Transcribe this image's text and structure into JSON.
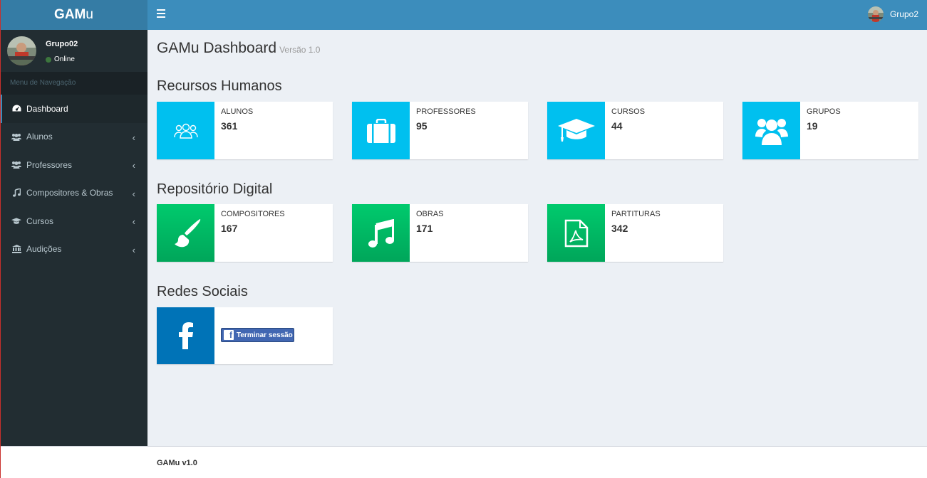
{
  "header": {
    "logo_bold": "GAM",
    "logo_rest": "u",
    "user_name": "Grupo2"
  },
  "sidebar": {
    "user_name": "Grupo02",
    "status": "Online",
    "menu_header": "Menu de Navegação",
    "items": [
      {
        "label": "Dashboard",
        "icon": "dashboard-icon"
      },
      {
        "label": "Alunos",
        "icon": "users-icon"
      },
      {
        "label": "Professores",
        "icon": "users-icon"
      },
      {
        "label": "Compositores & Obras",
        "icon": "music-icon"
      },
      {
        "label": "Cursos",
        "icon": "graduation-cap-icon"
      },
      {
        "label": "Audições",
        "icon": "institution-icon"
      }
    ],
    "chevron": "‹"
  },
  "main": {
    "title": "GAMu Dashboard",
    "version": "Versão 1.0",
    "sections": [
      {
        "title": "Recursos Humanos",
        "boxes": [
          {
            "label": "ALUNOS",
            "value": "361",
            "icon": "users-outline-icon",
            "color": "#00c0ef"
          },
          {
            "label": "PROFESSORES",
            "value": "95",
            "icon": "briefcase-icon",
            "color": "#00c0ef"
          },
          {
            "label": "CURSOS",
            "value": "44",
            "icon": "graduation-cap-icon",
            "color": "#00c0ef"
          },
          {
            "label": "GRUPOS",
            "value": "19",
            "icon": "users-icon",
            "color": "#00c0ef"
          }
        ]
      },
      {
        "title": "Repositório Digital",
        "boxes": [
          {
            "label": "COMPOSITORES",
            "value": "167",
            "icon": "paint-brush-icon",
            "color": "#00a65a"
          },
          {
            "label": "OBRAS",
            "value": "171",
            "icon": "music-icon",
            "color": "#00a65a"
          },
          {
            "label": "PARTITURAS",
            "value": "342",
            "icon": "file-pdf-icon",
            "color": "#00a65a"
          }
        ]
      },
      {
        "title": "Redes Sociais",
        "facebook_button": "Terminar sessão",
        "icon": "facebook-icon",
        "color": "#0073b7"
      }
    ]
  },
  "footer": {
    "text": "GAMu v1.0"
  }
}
